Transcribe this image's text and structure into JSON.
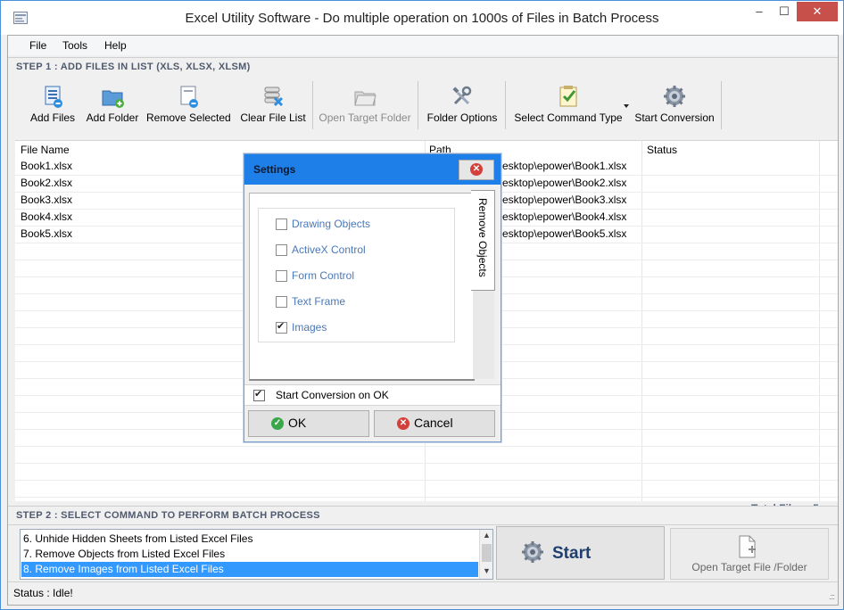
{
  "window": {
    "title": "Excel Utility Software - Do multiple operation on 1000s of Files in Batch Process",
    "minimize": "–",
    "maximize": "☐",
    "close": "✕"
  },
  "menu": [
    "File",
    "Tools",
    "Help"
  ],
  "step1": "STEP 1 : ADD FILES IN LIST (XLS, XLSX, XLSM)",
  "toolbar": [
    {
      "label": "Add Files",
      "icon": "add-files-icon",
      "enabled": true
    },
    {
      "label": "Add Folder",
      "icon": "add-folder-icon",
      "enabled": true
    },
    {
      "label": "Remove Selected",
      "icon": "remove-selected-icon",
      "enabled": true
    },
    {
      "label": "Clear File List",
      "icon": "clear-list-icon",
      "enabled": true
    },
    {
      "label": "Open Target Folder",
      "icon": "open-folder-icon",
      "enabled": false
    },
    {
      "label": "Folder Options",
      "icon": "tools-icon",
      "enabled": true
    },
    {
      "label": "Select Command Type",
      "icon": "checklist-icon",
      "enabled": true
    },
    {
      "label": "Start Conversion",
      "icon": "gear-icon",
      "enabled": true
    }
  ],
  "grid": {
    "headers": [
      "File Name",
      "Path",
      "Status"
    ],
    "rows": [
      {
        "name": "Book1.xlsx",
        "path": "esktop\\epower\\Book1.xlsx",
        "status": ""
      },
      {
        "name": "Book2.xlsx",
        "path": "esktop\\epower\\Book2.xlsx",
        "status": ""
      },
      {
        "name": "Book3.xlsx",
        "path": "esktop\\epower\\Book3.xlsx",
        "status": ""
      },
      {
        "name": "Book4.xlsx",
        "path": "esktop\\epower\\Book4.xlsx",
        "status": ""
      },
      {
        "name": "Book5.xlsx",
        "path": "esktop\\epower\\Book5.xlsx",
        "status": ""
      }
    ]
  },
  "total_files": "Total Files : 5",
  "step2": "STEP 2 : SELECT COMMAND TO PERFORM BATCH PROCESS",
  "commands": [
    {
      "label": "6. Unhide Hidden Sheets from Listed Excel Files",
      "selected": false
    },
    {
      "label": "7. Remove Objects from Listed Excel Files",
      "selected": false
    },
    {
      "label": "8. Remove Images from Listed Excel Files",
      "selected": true
    }
  ],
  "start_button": "Start",
  "open_target_button": "Open Target File /Folder",
  "status": "Status  :  Idle!",
  "dialog": {
    "title": "Settings",
    "tab": "Remove Objects",
    "options": [
      {
        "label": "Drawing Objects",
        "checked": false
      },
      {
        "label": "ActiveX Control",
        "checked": false
      },
      {
        "label": "Form Control",
        "checked": false
      },
      {
        "label": "Text Frame",
        "checked": false
      },
      {
        "label": "Images",
        "checked": true
      }
    ],
    "start_on_ok": "Start Conversion on OK",
    "ok": "OK",
    "cancel": "Cancel"
  },
  "colors": {
    "accent": "#1e7fe8",
    "selection": "#3399ff",
    "close": "#c7504b"
  }
}
